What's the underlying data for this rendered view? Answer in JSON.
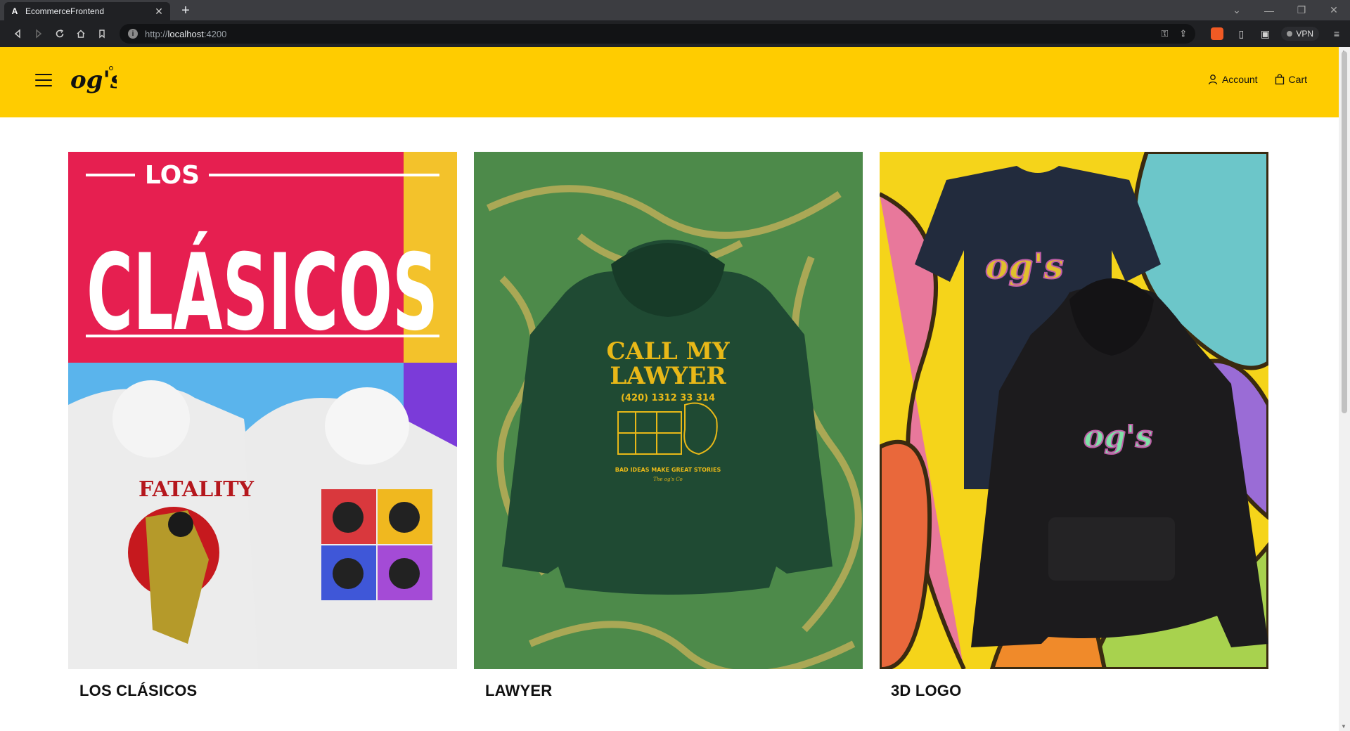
{
  "browser": {
    "tab_title": "EcommerceFrontend",
    "tab_favicon": "A",
    "new_tab": "+",
    "url_proto": "http://",
    "url_host": "localhost",
    "url_port": ":4200",
    "vpn_label": "VPN"
  },
  "header": {
    "logo_text": "og's",
    "nav": {
      "account_label": "Account",
      "cart_label": "Cart"
    },
    "background_color": "#ffcc00"
  },
  "collections": [
    {
      "label": "LOS CLÁSICOS",
      "image_text": [
        "LOS",
        "CLÁSICOS",
        "FATALITY"
      ]
    },
    {
      "label": "LAWYER",
      "image_text": [
        "CALL MY",
        "LAWYER",
        "(420) 1312 33 314",
        "BAD IDEAS MAKE GREAT STORIES",
        "The og's Co"
      ]
    },
    {
      "label": "3D LOGO",
      "image_text": [
        "og's",
        "og's"
      ]
    }
  ]
}
